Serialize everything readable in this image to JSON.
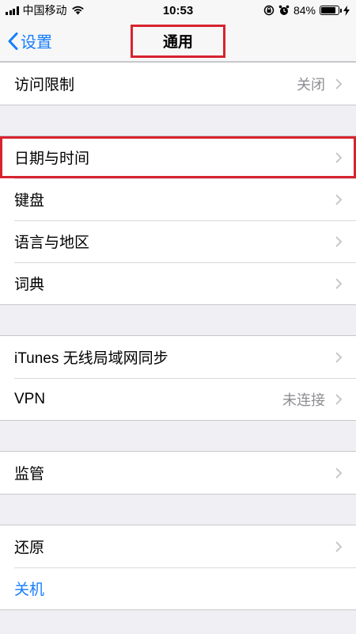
{
  "status": {
    "carrier": "中国移动",
    "time": "10:53",
    "battery_percent": "84%",
    "battery_level": 0.84
  },
  "nav": {
    "back_label": "设置",
    "title": "通用"
  },
  "groups": {
    "g1": [
      {
        "label": "访问限制",
        "value": "关闭"
      }
    ],
    "g2": [
      {
        "label": "日期与时间"
      },
      {
        "label": "键盘"
      },
      {
        "label": "语言与地区"
      },
      {
        "label": "词典"
      }
    ],
    "g3": [
      {
        "label": "iTunes 无线局域网同步"
      },
      {
        "label": "VPN",
        "value": "未连接"
      }
    ],
    "g4": [
      {
        "label": "监管"
      }
    ],
    "g5": [
      {
        "label": "还原"
      },
      {
        "label": "关机"
      }
    ]
  },
  "colors": {
    "accent": "#157efb",
    "highlight": "#d7232f"
  }
}
